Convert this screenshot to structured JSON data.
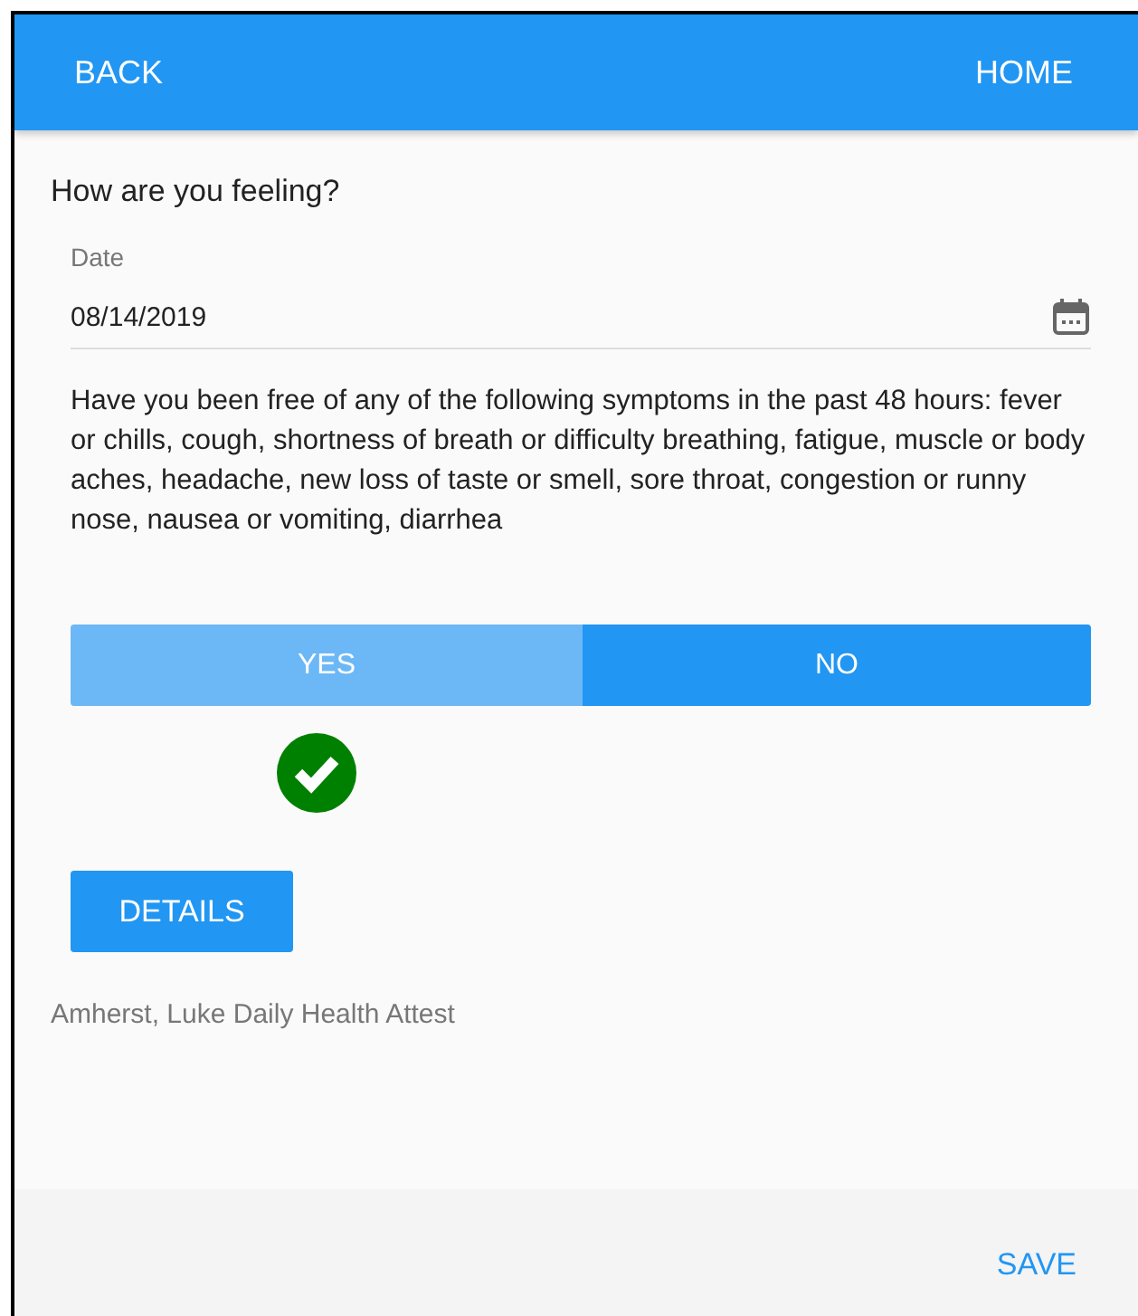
{
  "header": {
    "back": "BACK",
    "home": "HOME"
  },
  "question": "How are you feeling?",
  "date_field": {
    "label": "Date",
    "value": "08/14/2019"
  },
  "prompt": "Have you been free of any of the following symptoms in the past 48 hours: fever or chills, cough, shortness of breath or difficulty breathing, fatigue, muscle or body aches, headache, new loss of taste or smell, sore throat, congestion or runny nose, nausea or vomiting, diarrhea",
  "options": [
    {
      "label": "YES",
      "selected": true
    },
    {
      "label": "NO",
      "selected": false
    }
  ],
  "details_button": "DETAILS",
  "footer_text": "Amherst, Luke Daily Health Attest",
  "save_button": "SAVE"
}
